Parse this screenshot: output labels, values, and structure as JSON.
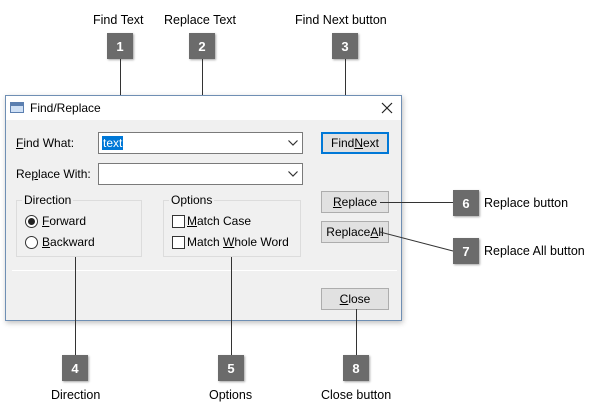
{
  "annotations": {
    "find_text": {
      "num": "1",
      "caption": "Find Text"
    },
    "replace_text": {
      "num": "2",
      "caption": "Replace Text"
    },
    "find_next": {
      "num": "3",
      "caption": "Find Next button"
    },
    "direction": {
      "num": "4",
      "caption": "Direction"
    },
    "options": {
      "num": "5",
      "caption": "Options"
    },
    "replace": {
      "num": "6",
      "caption": "Replace button"
    },
    "replace_all": {
      "num": "7",
      "caption": "Replace All button"
    },
    "close": {
      "num": "8",
      "caption": "Close button"
    }
  },
  "dialog": {
    "title": "Find/Replace",
    "find_label": {
      "accel": "F",
      "rest": "ind What:"
    },
    "find_value": "text",
    "replace_label": {
      "pre": "Re",
      "accel": "p",
      "rest": "lace With:"
    },
    "replace_value": "",
    "direction_title": "Direction",
    "forward": {
      "accel": "F",
      "rest": "orward",
      "checked": true
    },
    "backward": {
      "accel": "B",
      "rest": "ackward",
      "checked": false
    },
    "options_title": "Options",
    "match_case": {
      "accel": "M",
      "rest": "atch Case",
      "checked": false
    },
    "whole_word": {
      "pre": "Match ",
      "accel": "W",
      "rest": "hole Word",
      "checked": false
    },
    "find_next": {
      "pre": "Find ",
      "accel": "N",
      "rest": "ext"
    },
    "replace": {
      "accel": "R",
      "rest": "eplace"
    },
    "replace_all": {
      "pre": "Replace ",
      "accel": "A",
      "rest": "ll"
    },
    "close": {
      "accel": "C",
      "rest": "lose"
    }
  },
  "colors": {
    "badge": "#6b6b6b",
    "accent": "#0078d7"
  }
}
